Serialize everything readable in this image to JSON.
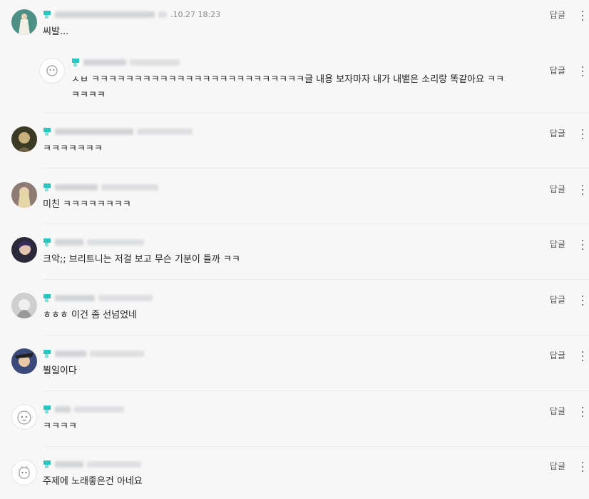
{
  "ui": {
    "reply_label": "답글",
    "more_label": "more options"
  },
  "colors": {
    "background": "#f7f7f7",
    "grade_icon": "#29c5c0",
    "divider": "#ececec"
  },
  "comments": [
    {
      "date": ".10.27 18:23",
      "text": "씨발..."
    },
    {
      "date": "",
      "text": "ㅅㅂ ㅋㅋㅋㅋㅋㅋㅋㅋㅋㅋㅋㅋㅋㅋㅋㅋㅋㅋㅋㅋㅋㅋㅋㅋㅋ글 내용 보자마자 내가 내뱉은 소리랑 똑같아요 ㅋㅋ\nㅋㅋㅋㅋ"
    },
    {
      "date": "",
      "text": "ㅋㅋㅋㅋㅋㅋㅋ"
    },
    {
      "date": "",
      "text": "미친 ㅋㅋㅋㅋㅋㅋㅋㅋ"
    },
    {
      "date": "",
      "text": "크악;; 브리트니는 저걸 보고 무슨 기분이 들까 ㅋㅋ"
    },
    {
      "date": "",
      "text": "ㅎㅎㅎ 이건 좀 선넘었네"
    },
    {
      "date": "",
      "text": "뵐일이다"
    },
    {
      "date": "",
      "text": "ㅋㅋㅋㅋ"
    },
    {
      "date": "",
      "text": "주제에 노래좋은건 아네요"
    }
  ]
}
